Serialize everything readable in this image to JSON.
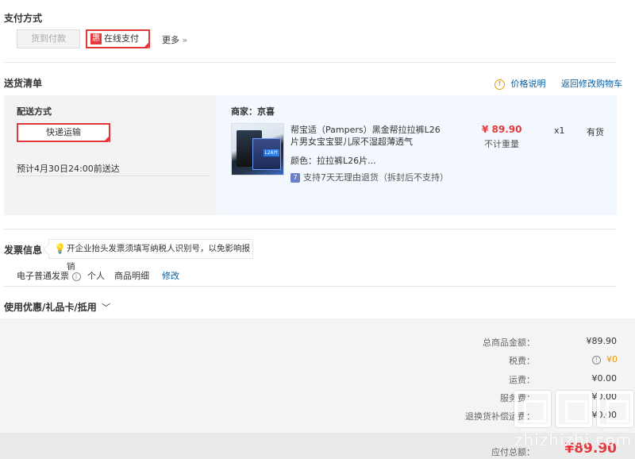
{
  "payment": {
    "title": "支付方式",
    "cod_label": "货到付款",
    "online_badge": "惠",
    "online_label": "在线支付",
    "more_label": "更多",
    "more_arrow": "»"
  },
  "shipping_list": {
    "title": "送货清单",
    "price_note": "价格说明",
    "back_to_cart": "返回修改购物车"
  },
  "delivery": {
    "method_title": "配送方式",
    "method_selected": "快递运输",
    "eta": "预计4月30日24:00前送达"
  },
  "merchant": {
    "label": "商家：京喜"
  },
  "product": {
    "name": "帮宝适（Pampers）黑金帮拉拉裤L26片男女宝宝婴儿尿不湿超薄透气",
    "price": "¥ 89.90",
    "weight_note": "不计重量",
    "quantity": "x1",
    "stock": "有货",
    "color_label": "颜色：拉拉裤L26片...",
    "return_badge": "7",
    "return_policy": "支持7天无理由退货（拆封后不支持）",
    "image_tag": "L26片"
  },
  "invoice": {
    "title": "发票信息",
    "tip": "开企业抬头发票须填写纳税人识别号，以免影响报销",
    "type": "电子普通发票",
    "info_icon": "i",
    "holder": "个人",
    "content": "商品明细",
    "edit": "修改"
  },
  "coupon": {
    "title": "使用优惠/礼品卡/抵用",
    "chevron": "﹀"
  },
  "summary": {
    "rows": [
      {
        "label": "总商品金额：",
        "value": "¥89.90"
      },
      {
        "label": "税费：",
        "value": "¥0"
      },
      {
        "label": "运费：",
        "value": "¥0.00"
      },
      {
        "label": "服务费：",
        "value": "¥0.00"
      },
      {
        "label": "退换货补偿运费：",
        "value": "¥0.00"
      }
    ],
    "total_label": "应付总额：",
    "total_value": "¥89.90",
    "tax_icon": "!"
  },
  "watermark": {
    "text": "zhizhizhi.com"
  },
  "colors": {
    "accent_red": "#e4393c",
    "link_blue": "#005ea7",
    "warning_orange": "#e69a00"
  }
}
